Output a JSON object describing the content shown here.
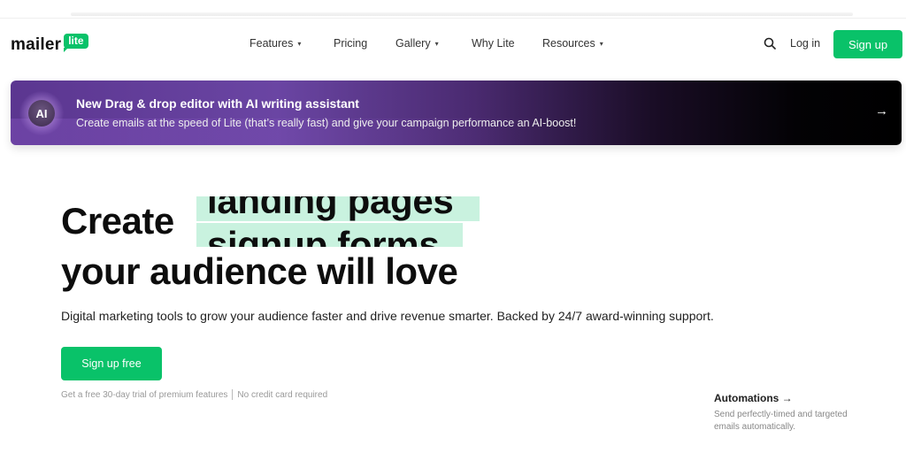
{
  "nav": {
    "logo_text": "mailer",
    "logo_badge": "lite",
    "menu": [
      {
        "label": "Features",
        "has_dropdown": true
      },
      {
        "label": "Pricing",
        "has_dropdown": false
      },
      {
        "label": "Gallery",
        "has_dropdown": true
      },
      {
        "label": "Why Lite",
        "has_dropdown": false
      },
      {
        "label": "Resources",
        "has_dropdown": true
      }
    ],
    "search_icon": "search-icon",
    "login_label": "Log in",
    "signup_label": "Sign up",
    "chevron": "⌄"
  },
  "banner": {
    "badge": "AI",
    "title": "New Drag & drop editor with AI writing assistant",
    "subtitle": "Create emails at the speed of Lite (that’s really fast) and give your campaign performance an AI-boost!",
    "arrow": "→"
  },
  "hero": {
    "line1_prefix": "Create",
    "rotating_words": [
      "landing pages",
      "signup forms"
    ],
    "line2": "your audience will love",
    "subtitle": "Digital marketing tools to grow your audience faster and drive revenue smarter. Backed by 24/7 award-winning support.",
    "cta_label": "Sign up free",
    "fine_print_1": "Get a free 30-day trial of premium features",
    "fine_print_2": "No credit card required"
  },
  "feature_card": {
    "title": "Automations →",
    "description": "Send perfectly-timed and targeted emails automatically."
  },
  "colors": {
    "brand_green": "#09c269",
    "highlight_mint": "#c9f2df",
    "banner_purple": "#6a45a3"
  }
}
